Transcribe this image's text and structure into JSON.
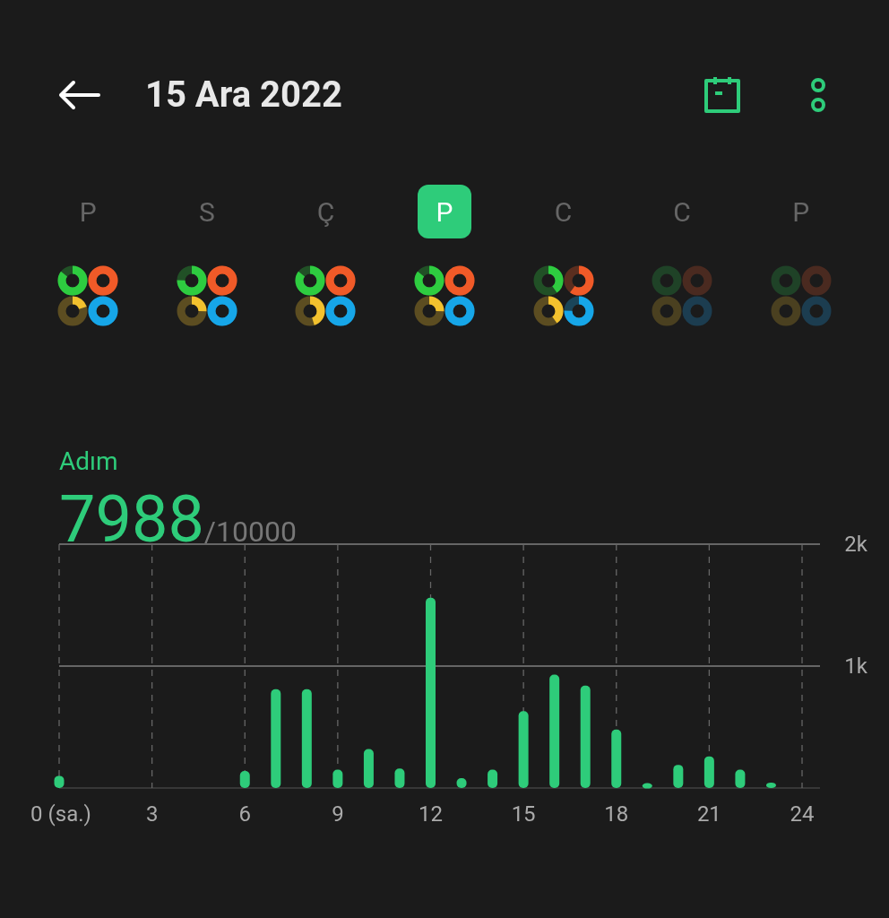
{
  "header": {
    "title": "15 Ara 2022"
  },
  "days": [
    {
      "label": "P",
      "selected": false,
      "rings": [
        {
          "color": "#2ecc40",
          "level": 0.85
        },
        {
          "color": "#f05a28",
          "level": 1
        },
        {
          "color": "#f2c12e",
          "level": 0.2
        },
        {
          "color": "#16a6e8",
          "level": 1
        }
      ]
    },
    {
      "label": "S",
      "selected": false,
      "rings": [
        {
          "color": "#2ecc40",
          "level": 0.75
        },
        {
          "color": "#f05a28",
          "level": 1
        },
        {
          "color": "#f2c12e",
          "level": 0.25
        },
        {
          "color": "#16a6e8",
          "level": 1
        }
      ]
    },
    {
      "label": "Ç",
      "selected": false,
      "rings": [
        {
          "color": "#2ecc40",
          "level": 0.85
        },
        {
          "color": "#f05a28",
          "level": 1
        },
        {
          "color": "#f2c12e",
          "level": 0.45
        },
        {
          "color": "#16a6e8",
          "level": 1
        }
      ]
    },
    {
      "label": "P",
      "selected": true,
      "rings": [
        {
          "color": "#2ecc40",
          "level": 0.85
        },
        {
          "color": "#f05a28",
          "level": 1
        },
        {
          "color": "#f2c12e",
          "level": 0.25
        },
        {
          "color": "#16a6e8",
          "level": 1
        }
      ]
    },
    {
      "label": "C",
      "selected": false,
      "rings": [
        {
          "color": "#2ecc40",
          "level": 0.4
        },
        {
          "color": "#f05a28",
          "level": 0.6
        },
        {
          "color": "#f2c12e",
          "level": 0.4
        },
        {
          "color": "#16a6e8",
          "level": 0.75
        }
      ]
    },
    {
      "label": "C",
      "selected": false,
      "rings": [
        {
          "color": "#1f4227",
          "level": 0
        },
        {
          "color": "#4a2a20",
          "level": 0
        },
        {
          "color": "#4a4020",
          "level": 0
        },
        {
          "color": "#1c3d50",
          "level": 0
        }
      ]
    },
    {
      "label": "P",
      "selected": false,
      "rings": [
        {
          "color": "#1f4227",
          "level": 0
        },
        {
          "color": "#4a2a20",
          "level": 0
        },
        {
          "color": "#4a4020",
          "level": 0
        },
        {
          "color": "#1c3d50",
          "level": 0
        }
      ]
    }
  ],
  "steps": {
    "label": "Adım",
    "value": "7988",
    "goal": "/10000",
    "chart_data": {
      "type": "bar",
      "x": [
        0,
        6,
        7,
        8,
        9,
        10,
        11,
        12,
        13,
        14,
        15,
        16,
        17,
        18,
        19,
        20,
        21,
        22,
        23
      ],
      "xlim": [
        0,
        24
      ],
      "grid": true,
      "series": [
        {
          "color": "#2ecc7a",
          "values": [
            100,
            140,
            810,
            810,
            150,
            320,
            160,
            1560,
            80,
            150,
            630,
            930,
            840,
            480,
            40,
            190,
            260,
            150,
            45
          ]
        }
      ],
      "ylim": [
        0,
        2000
      ],
      "ref_lines": [
        {
          "axis": "y",
          "value": 1000
        }
      ],
      "yticks": [
        {
          "value": 1000,
          "label": "1k"
        },
        {
          "value": 2000,
          "label": "2k"
        }
      ],
      "xticks": [
        {
          "value": 0,
          "label": "0 (sa.)"
        },
        {
          "value": 3,
          "label": "3"
        },
        {
          "value": 6,
          "label": "6"
        },
        {
          "value": 9,
          "label": "9"
        },
        {
          "value": 12,
          "label": "12"
        },
        {
          "value": 15,
          "label": "15"
        },
        {
          "value": 18,
          "label": "18"
        },
        {
          "value": 21,
          "label": "21"
        },
        {
          "value": 24,
          "label": "24"
        }
      ]
    }
  }
}
